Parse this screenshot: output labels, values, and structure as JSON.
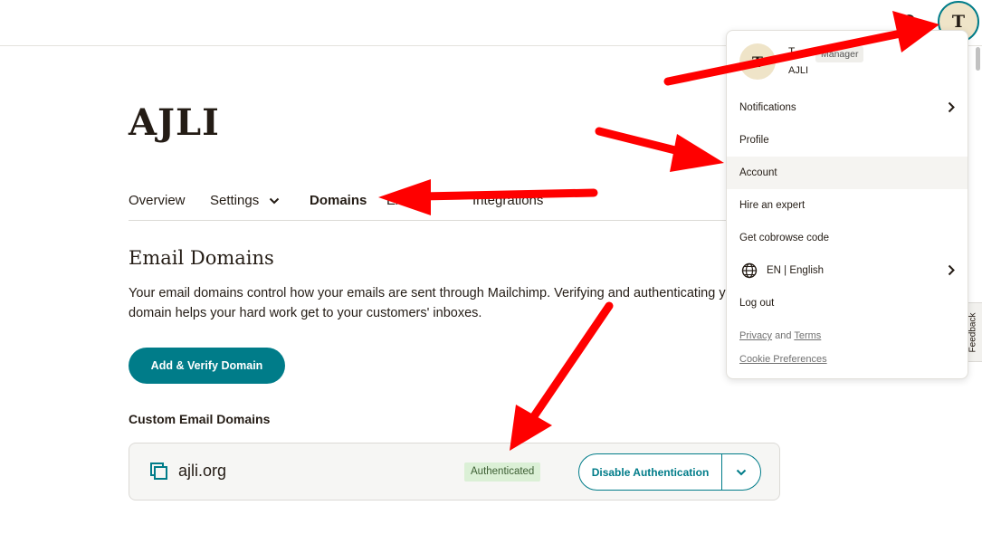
{
  "header": {
    "search_icon": "search-icon",
    "avatar_initial": "T"
  },
  "page": {
    "title": "AJLI"
  },
  "tabs": [
    {
      "label": "Overview",
      "active": false
    },
    {
      "label": "Settings",
      "active": false,
      "dropdown": true
    },
    {
      "label": "Domains",
      "active": true
    },
    {
      "label": "Ex",
      "active": false
    },
    {
      "label": "Integrations",
      "active": false
    }
  ],
  "email_domains": {
    "title": "Email Domains",
    "description": "Your email domains control how your emails are sent through Mailchimp. Verifying and authenticating your domain helps your hard work get to your customers' inboxes.",
    "add_button": "Add & Verify Domain",
    "custom_label": "Custom Email Domains",
    "domains": [
      {
        "name": "ajli.org",
        "status": "Authenticated",
        "action": "Disable Authentication"
      }
    ]
  },
  "account_menu": {
    "avatar_initial": "T",
    "user_name": "T",
    "role": "Manager",
    "org": "AJLI",
    "items": [
      {
        "label": "Notifications",
        "has_submenu": true
      },
      {
        "label": "Profile"
      },
      {
        "label": "Account",
        "highlighted": true
      },
      {
        "label": "Hire an expert"
      },
      {
        "label": "Get cobrowse code"
      },
      {
        "label": "EN | English",
        "has_submenu": true,
        "icon": "globe-icon"
      },
      {
        "label": "Log out"
      }
    ],
    "links": {
      "privacy": "Privacy",
      "and": "and",
      "terms": "Terms",
      "cookie": "Cookie Preferences"
    }
  },
  "feedback": {
    "label": "Feedback"
  },
  "colors": {
    "primary": "#007c89",
    "text": "#241c15",
    "badge_bg": "#dbf0d6",
    "annotation_arrow": "#ff0000"
  }
}
